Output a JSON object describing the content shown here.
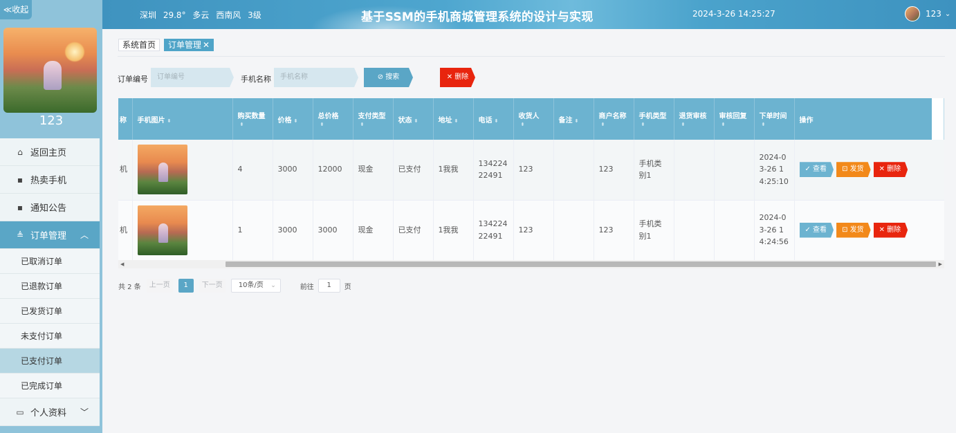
{
  "sidebar": {
    "collapse_label": "≪收起",
    "username": "123",
    "menu": [
      {
        "label": "返回主页",
        "icon": "home-icon",
        "glyph": "⌂"
      },
      {
        "label": "热卖手机",
        "icon": "grid-icon",
        "glyph": "▪"
      },
      {
        "label": "通知公告",
        "icon": "grid-icon",
        "glyph": "▪"
      }
    ],
    "order_menu": {
      "label": "订单管理",
      "icon": "bag-icon",
      "glyph": "≜"
    },
    "order_sub": [
      "已取消订单",
      "已退款订单",
      "已发货订单",
      "未支付订单",
      "已支付订单",
      "已完成订单"
    ],
    "profile": {
      "label": "个人资料",
      "icon": "id-card-icon",
      "glyph": "▭"
    }
  },
  "header": {
    "weather": {
      "city": "深圳",
      "temp": "29.8°",
      "sky": "多云",
      "wind": "西南风",
      "level": "3级"
    },
    "title": "基于SSM的手机商城管理系统的设计与实现",
    "datetime": "2024-3-26 14:25:27",
    "user": "123"
  },
  "tabs": {
    "home": "系统首页",
    "current": "订单管理",
    "close": "✕"
  },
  "search": {
    "order_no_label": "订单编号",
    "order_no_placeholder": "订单编号",
    "phone_name_label": "手机名称",
    "phone_name_placeholder": "手机名称",
    "search_label": "⊘ 搜索",
    "delete_label": "✕ 删除"
  },
  "table": {
    "headers": [
      "称",
      "手机图片",
      "购买数量",
      "价格",
      "总价格",
      "支付类型",
      "状态",
      "地址",
      "电话",
      "收货人",
      "备注",
      "商户名称",
      "手机类型",
      "退货审核",
      "审核回复",
      "下单时间",
      "操作"
    ],
    "rows": [
      {
        "name": "机",
        "qty": "4",
        "price": "3000",
        "total": "12000",
        "pay": "现金",
        "status": "已支付",
        "addr": "1我我",
        "phone": "13422422491",
        "receiver": "123",
        "note": "",
        "merchant": "123",
        "type": "手机类别1",
        "return_audit": "",
        "audit_reply": "",
        "time": "2024-03-26 14:25:10"
      },
      {
        "name": "机",
        "qty": "1",
        "price": "3000",
        "total": "3000",
        "pay": "现金",
        "status": "已支付",
        "addr": "1我我",
        "phone": "13422422491",
        "receiver": "123",
        "note": "",
        "merchant": "123",
        "type": "手机类别1",
        "return_audit": "",
        "audit_reply": "",
        "time": "2024-03-26 14:24:56"
      }
    ],
    "actions": {
      "view": "✓ 查看",
      "ship": "⊡ 发货",
      "delete": "✕ 删除"
    }
  },
  "pager": {
    "total": "共 2 条",
    "prev": "上一页",
    "page": "1",
    "next": "下一页",
    "size": "10条/页",
    "goto": "前往",
    "goto_value": "1",
    "unit": "页"
  }
}
